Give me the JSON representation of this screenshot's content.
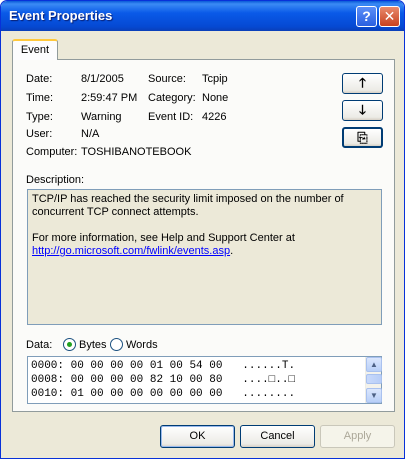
{
  "window": {
    "title": "Event Properties",
    "help_glyph": "?",
    "close_glyph": "✕"
  },
  "tab": {
    "label": "Event"
  },
  "event": {
    "date_label": "Date:",
    "date": "8/1/2005",
    "time_label": "Time:",
    "time": "2:59:47 PM",
    "type_label": "Type:",
    "type": "Warning",
    "user_label": "User:",
    "user": "N/A",
    "computer_label": "Computer:",
    "computer": "TOSHIBANOTEBOOK",
    "source_label": "Source:",
    "source": "Tcpip",
    "category_label": "Category:",
    "category": "None",
    "event_id_label": "Event ID:",
    "event_id": "4226"
  },
  "nav": {
    "up_icon": "arrow-up-icon",
    "up_glyph": "🡑",
    "down_icon": "arrow-down-icon",
    "down_glyph": "🡓",
    "copy_icon": "copy-icon",
    "copy_glyph": "⎘"
  },
  "description": {
    "label": "Description:",
    "line1": "TCP/IP has reached the security limit imposed on the number of",
    "line2": "concurrent TCP connect attempts.",
    "line3": "For more information, see Help and Support Center at",
    "link": "http://go.microsoft.com/fwlink/events.asp",
    "link_suffix": "."
  },
  "data": {
    "label": "Data:",
    "bytes_label": "Bytes",
    "words_label": "Words",
    "selected": "Bytes",
    "rows": [
      {
        "offset": "0000:",
        "hex": "00 00 00 00 01 00 54 00",
        "ascii": "......T."
      },
      {
        "offset": "0008:",
        "hex": "00 00 00 00 82 10 00 80",
        "ascii": "....□..□"
      },
      {
        "offset": "0010:",
        "hex": "01 00 00 00 00 00 00 00",
        "ascii": "........"
      }
    ]
  },
  "buttons": {
    "ok": "OK",
    "cancel": "Cancel",
    "apply": "Apply"
  }
}
